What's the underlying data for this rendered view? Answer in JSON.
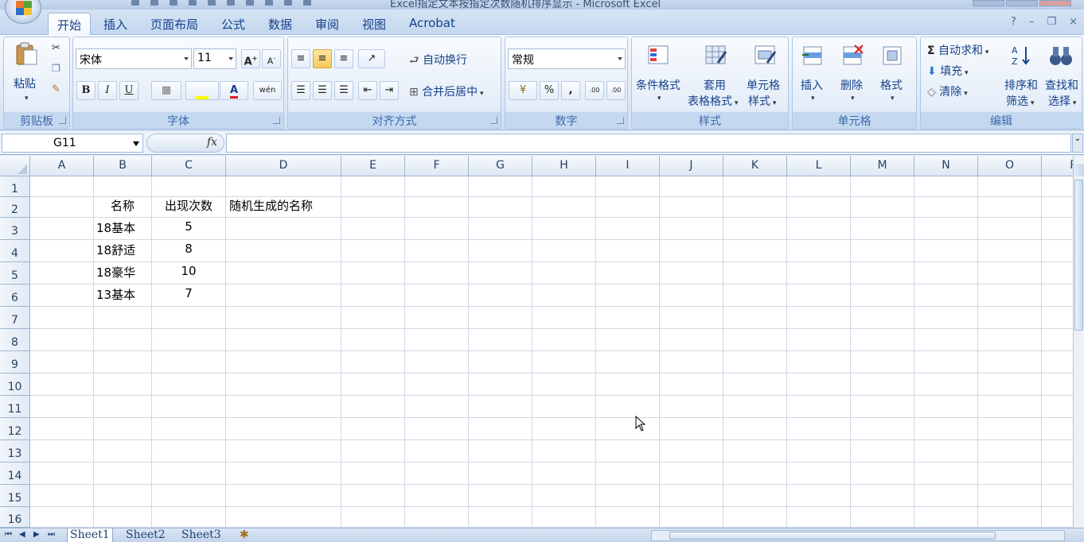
{
  "window": {
    "title": "Excel指定文本按指定次数随机排序显示 - Microsoft Excel"
  },
  "ribbon_tabs": [
    "开始",
    "插入",
    "页面布局",
    "公式",
    "数据",
    "审阅",
    "视图",
    "Acrobat"
  ],
  "active_tab": "开始",
  "clipboard": {
    "paste_label": "粘贴",
    "group_label": "剪贴板"
  },
  "font": {
    "font_name": "宋体",
    "font_size": "11",
    "group_label": "字体",
    "bold": "B",
    "italic": "I",
    "underline": "U",
    "grow": "A",
    "shrink": "A",
    "font_color": "A",
    "phonetic": "wén"
  },
  "alignment": {
    "wrap_text": "自动换行",
    "merge_center": "合并后居中",
    "group_label": "对齐方式"
  },
  "number": {
    "format": "常规",
    "percent": "%",
    "comma": ",",
    "increase_decimal": ".00",
    "decrease_decimal": ".00",
    "group_label": "数字"
  },
  "styles": {
    "conditional_format": "条件格式",
    "table_format_line1": "套用",
    "table_format_line2": "表格格式",
    "cell_style_line1": "单元格",
    "cell_style_line2": "样式",
    "group_label": "样式"
  },
  "cells": {
    "insert": "插入",
    "delete": "删除",
    "format": "格式",
    "group_label": "单元格"
  },
  "editing": {
    "autosum": "自动求和",
    "fill": "填充",
    "clear": "清除",
    "sort_filter_line1": "排序和",
    "sort_filter_line2": "筛选",
    "find_select_line1": "查找和",
    "find_select_line2": "选择",
    "autosum_symbol": "Σ",
    "group_label": "编辑"
  },
  "formula_bar": {
    "name_box": "G11",
    "fx_label": "fx",
    "formula": ""
  },
  "sheet": {
    "columns": [
      "A",
      "B",
      "C",
      "D",
      "E",
      "F",
      "G",
      "H",
      "I",
      "J",
      "K",
      "L",
      "M",
      "N",
      "O",
      "P"
    ],
    "rows": [
      "1",
      "2",
      "3",
      "4",
      "5",
      "6",
      "7",
      "8",
      "9",
      "10",
      "11",
      "12",
      "13",
      "14",
      "15",
      "16"
    ],
    "header_row": {
      "b": "名称",
      "c": "出现次数",
      "d": "随机生成的名称"
    },
    "data_rows": [
      {
        "name": "18基本",
        "count": "5"
      },
      {
        "name": "18舒适",
        "count": "8"
      },
      {
        "name": "18豪华",
        "count": "10"
      },
      {
        "name": "13基本",
        "count": "7"
      }
    ]
  },
  "sheet_tabs": [
    "Sheet1",
    "Sheet2",
    "Sheet3"
  ],
  "active_sheet": "Sheet1"
}
